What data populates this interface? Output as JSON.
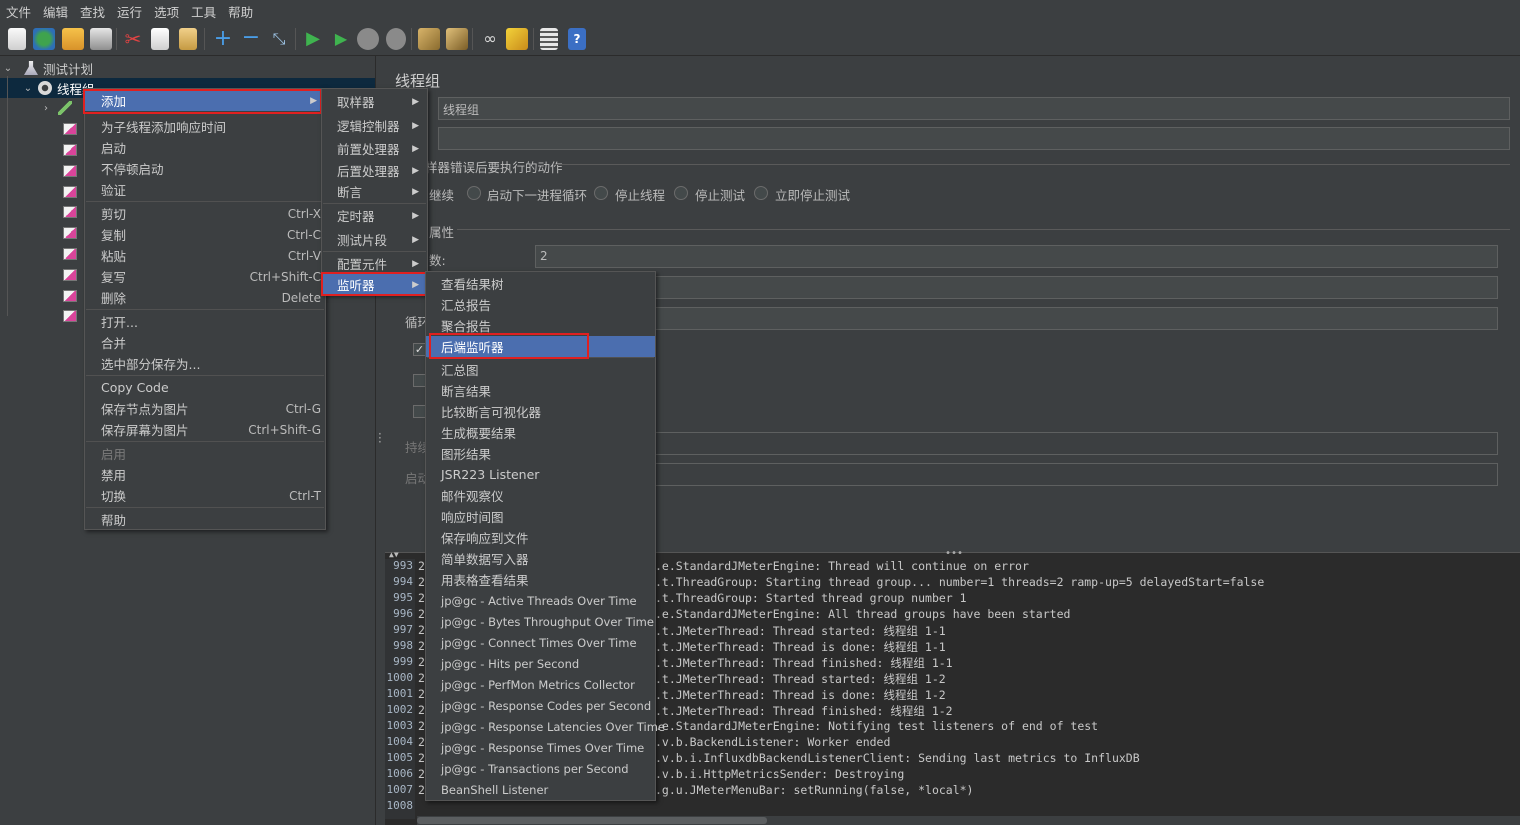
{
  "menubar": [
    "文件",
    "编辑",
    "查找",
    "运行",
    "选项",
    "工具",
    "帮助"
  ],
  "tree": {
    "root_label": "测试计划",
    "thread_group_label": "线程组"
  },
  "right": {
    "title": "线程组",
    "name_value": "线程组",
    "comment_value": "",
    "error_action_label": "样器错误后要执行的动作",
    "radio_continue": "继续",
    "radio_next_loop": "启动下一进程循环",
    "radio_stop_thread": "停止线程",
    "radio_stop_test": "停止测试",
    "radio_stop_now": "立即停止测试",
    "props_label": "属性",
    "threads_label": "数:",
    "threads_value": "2",
    "loop_label": "循环",
    "duration_label": "持续",
    "delay_label": "启动"
  },
  "context_menu": {
    "add": "添加",
    "add_think_time": "为子线程添加响应时间",
    "start": "启动",
    "start_no_pause": "不停顿启动",
    "validate": "验证",
    "cut": "剪切",
    "cut_sc": "Ctrl-X",
    "copy": "复制",
    "copy_sc": "Ctrl-C",
    "paste": "粘贴",
    "paste_sc": "Ctrl-V",
    "overwrite": "复写",
    "overwrite_sc": "Ctrl+Shift-C",
    "delete": "删除",
    "delete_sc": "Delete",
    "open": "打开...",
    "merge": "合并",
    "save_selection": "选中部分保存为...",
    "copy_code": "Copy Code",
    "save_node_image": "保存节点为图片",
    "save_node_image_sc": "Ctrl-G",
    "save_screen_image": "保存屏幕为图片",
    "save_screen_image_sc": "Ctrl+Shift-G",
    "enable": "启用",
    "disable": "禁用",
    "toggle": "切换",
    "toggle_sc": "Ctrl-T",
    "help": "帮助"
  },
  "add_submenu": [
    "取样器",
    "逻辑控制器",
    "前置处理器",
    "后置处理器",
    "断言",
    "定时器",
    "测试片段",
    "配置元件",
    "监听器"
  ],
  "listener_submenu": [
    "查看结果树",
    "汇总报告",
    "聚合报告",
    "后端监听器",
    "汇总图",
    "断言结果",
    "比较断言可视化器",
    "生成概要结果",
    "图形结果",
    "JSR223 Listener",
    "邮件观察仪",
    "响应时间图",
    "保存响应到文件",
    "简单数据写入器",
    "用表格查看结果",
    "jp@gc - Active Threads Over Time",
    "jp@gc - Bytes Throughput Over Time",
    "jp@gc - Connect Times Over Time",
    "jp@gc - Hits per Second",
    "jp@gc - PerfMon Metrics Collector",
    "jp@gc - Response Codes per Second",
    "jp@gc - Response Latencies Over Time",
    "jp@gc - Response Times Over Time",
    "jp@gc - Transactions per Second",
    "BeanShell Listener"
  ],
  "log": {
    "lines": [
      {
        "n": "993",
        "t": ".e.StandardJMeterEngine: Thread will continue on error"
      },
      {
        "n": "994",
        "t": ".t.ThreadGroup: Starting thread group... number=1 threads=2 ramp-up=5 delayedStart=false"
      },
      {
        "n": "995",
        "t": ".t.ThreadGroup: Started thread group number 1"
      },
      {
        "n": "996",
        "t": ".e.StandardJMeterEngine: All thread groups have been started"
      },
      {
        "n": "997",
        "t": ".t.JMeterThread: Thread started: 线程组 1-1"
      },
      {
        "n": "998",
        "t": ".t.JMeterThread: Thread is done: 线程组 1-1"
      },
      {
        "n": "999",
        "t": ".t.JMeterThread: Thread finished: 线程组 1-1"
      },
      {
        "n": "1000",
        "t": ".t.JMeterThread: Thread started: 线程组 1-2"
      },
      {
        "n": "1001",
        "t": ".t.JMeterThread: Thread is done: 线程组 1-2"
      },
      {
        "n": "1002",
        "t": ".t.JMeterThread: Thread finished: 线程组 1-2"
      },
      {
        "n": "1003",
        "t": ".e.StandardJMeterEngine: Notifying test listeners of end of test"
      },
      {
        "n": "1004",
        "t": ".v.b.BackendListener: Worker ended"
      },
      {
        "n": "1005",
        "t": ".v.b.i.InfluxdbBackendListenerClient: Sending last metrics to InfluxDB"
      },
      {
        "n": "1006",
        "t": ".v.b.i.HttpMetricsSender: Destroying"
      },
      {
        "n": "1007",
        "t": ".g.u.JMeterMenuBar: setRunning(false, *local*)"
      },
      {
        "n": "1008",
        "t": ""
      }
    ],
    "gutter_left": [
      "2",
      "2",
      "2",
      "2",
      "2",
      "2",
      "2",
      "2",
      "2",
      "2",
      "2",
      "2",
      "2",
      "2",
      "2",
      ""
    ]
  },
  "colors": {
    "accent": "#4b6eaf",
    "highlight_border": "#e02020",
    "background": "#3c3f41"
  }
}
